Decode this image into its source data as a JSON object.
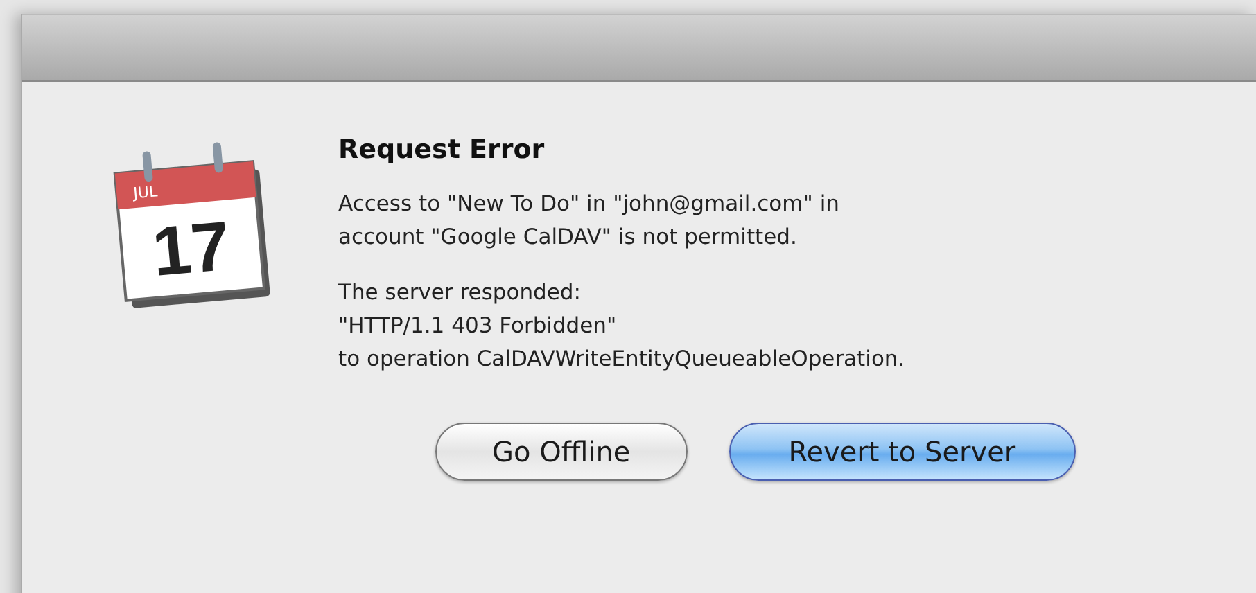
{
  "icon": {
    "month": "JUL",
    "day": "17"
  },
  "title": "Request Error",
  "paragraphs": [
    {
      "lines": [
        "Access to \"New To Do\" in \"john@gmail.com\" in",
        "account \"Google CalDAV\" is not permitted."
      ]
    },
    {
      "lines": [
        "The server responded:",
        "\"HTTP/1.1 403 Forbidden\"",
        "to operation CalDAVWriteEntityQueueableOperation."
      ]
    }
  ],
  "buttons": [
    {
      "label": "Go Offline",
      "default": false
    },
    {
      "label": "Revert to Server",
      "default": true
    }
  ]
}
